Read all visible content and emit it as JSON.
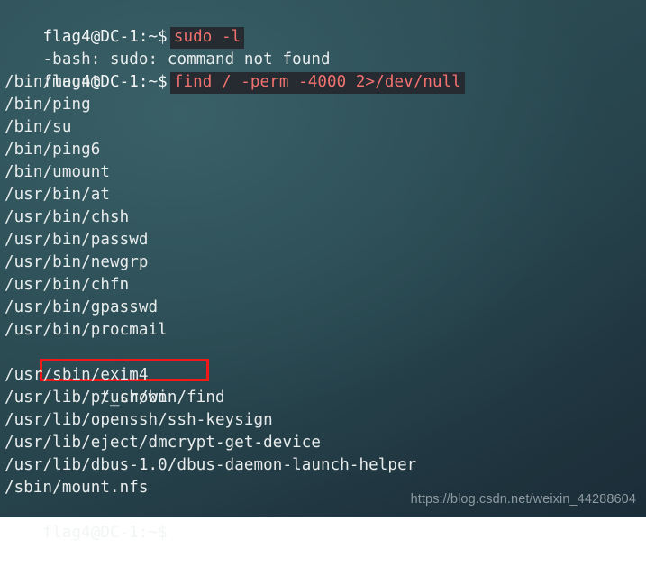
{
  "terminal": {
    "shell_prompt": "flag4@DC-1:~$",
    "colors": {
      "background_top_left": "#35585f",
      "background_bottom_right": "#1b2d38",
      "foreground": "#e8ecec",
      "command_text": "#f2726f",
      "command_block_bg": "#262b32",
      "highlight_box_border": "#f01818",
      "watermark_text": "#8e9aa0"
    },
    "lines": [
      {
        "type": "prompt-command",
        "prompt": "flag4@DC-1:~$",
        "command": "sudo -l"
      },
      {
        "type": "output",
        "text": "-bash: sudo: command not found"
      },
      {
        "type": "prompt-command",
        "prompt": "flag4@DC-1:~$",
        "command": "find / -perm -4000 2>/dev/null"
      },
      {
        "type": "output",
        "text": "/bin/mount"
      },
      {
        "type": "output",
        "text": "/bin/ping"
      },
      {
        "type": "output",
        "text": "/bin/su"
      },
      {
        "type": "output",
        "text": "/bin/ping6"
      },
      {
        "type": "output",
        "text": "/bin/umount"
      },
      {
        "type": "output",
        "text": "/usr/bin/at"
      },
      {
        "type": "output",
        "text": "/usr/bin/chsh"
      },
      {
        "type": "output",
        "text": "/usr/bin/passwd"
      },
      {
        "type": "output",
        "text": "/usr/bin/newgrp"
      },
      {
        "type": "output",
        "text": "/usr/bin/chfn"
      },
      {
        "type": "output",
        "text": "/usr/bin/gpasswd"
      },
      {
        "type": "output",
        "text": "/usr/bin/procmail"
      },
      {
        "type": "output-highlighted",
        "text": "/usr/bin/find"
      },
      {
        "type": "output",
        "text": "/usr/sbin/exim4"
      },
      {
        "type": "output",
        "text": "/usr/lib/pt_chown"
      },
      {
        "type": "output",
        "text": "/usr/lib/openssh/ssh-keysign"
      },
      {
        "type": "output",
        "text": "/usr/lib/eject/dmcrypt-get-device"
      },
      {
        "type": "output",
        "text": "/usr/lib/dbus-1.0/dbus-daemon-launch-helper"
      },
      {
        "type": "output",
        "text": "/sbin/mount.nfs"
      },
      {
        "type": "prompt-only",
        "prompt": "flag4@DC-1:~$"
      }
    ]
  },
  "watermark": {
    "text": "https://blog.csdn.net/weixin_44288604"
  }
}
